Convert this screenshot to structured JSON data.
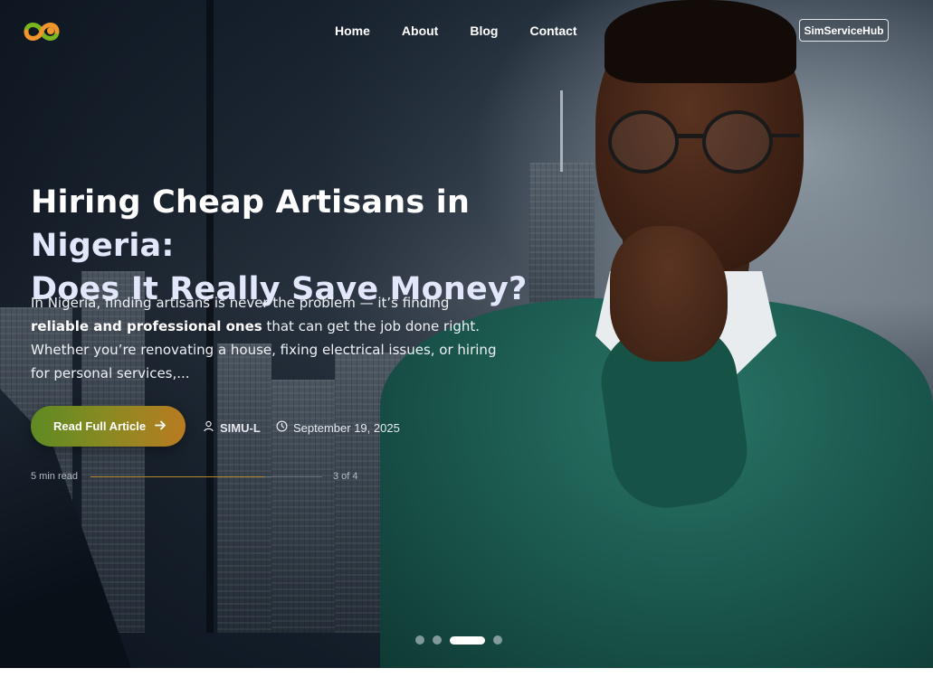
{
  "nav": {
    "logo_alt": "logo-icon",
    "links": [
      "Home",
      "About",
      "Blog",
      "Contact"
    ],
    "brand_button": "SimServiceHub"
  },
  "hero": {
    "title_part1": "Hiring Cheap Artisans in ",
    "title_accent1": "Nigeria:",
    "title_accent2": "Does It Really Save Money?",
    "excerpt_part1": "In Nigeria, finding artisans is never the problem — it’s finding ",
    "excerpt_bold": "reliable and professional ones",
    "excerpt_part2": " that can get the job done right. Whether you’re renovating a house, fixing electrical issues, or hiring for personal services,...",
    "cta_label": "Read Full Article",
    "author": "SIMU-L",
    "date": "September 19, 2025",
    "read_time": "5 min read",
    "slide_count": "3 of 4",
    "progress": 0.75,
    "slides_total": 4,
    "active_slide": 3
  },
  "colors": {
    "cta_start": "#5f8a23",
    "cta_end": "#b97b21",
    "progress_fill": "#b28a2c",
    "accent_text": "#e3e7fb"
  },
  "icons": {
    "author": "user-icon",
    "date": "clock-icon",
    "cta": "arrow-right-icon"
  }
}
